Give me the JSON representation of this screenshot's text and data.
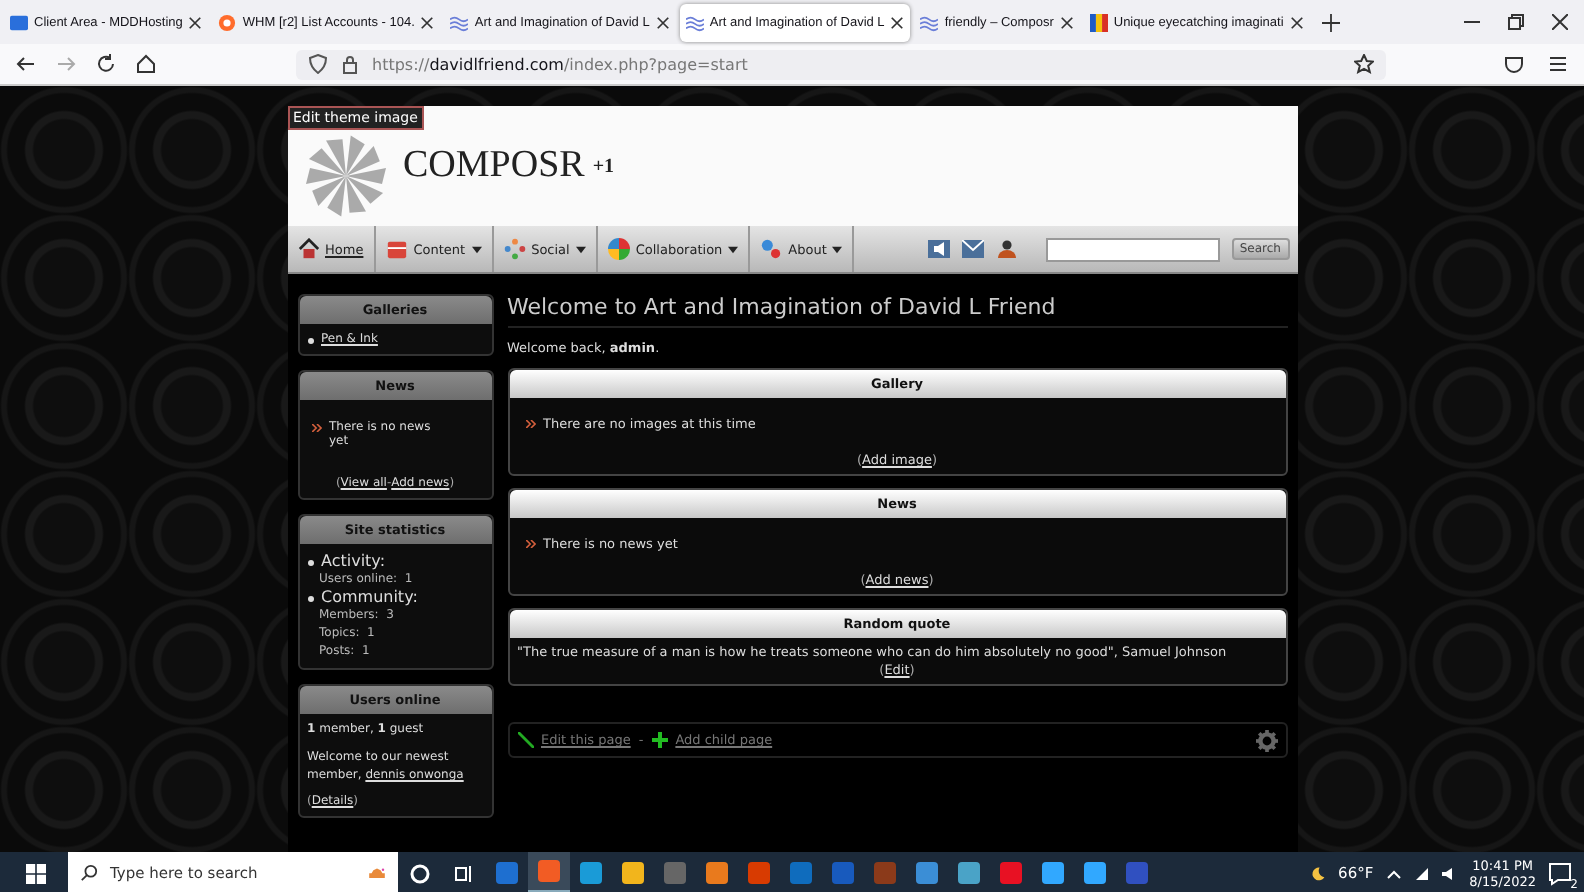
{
  "browser": {
    "tabs": [
      {
        "title": "Client Area - MDDHosting",
        "selected": false
      },
      {
        "title": "WHM [r2] List Accounts - 104.",
        "selected": false
      },
      {
        "title": "Art and Imagination of David L",
        "selected": false
      },
      {
        "title": "Art and Imagination of David L",
        "selected": true
      },
      {
        "title": "friendly – Composr",
        "selected": false
      },
      {
        "title": "Unique eyecatching imaginati",
        "selected": false
      }
    ],
    "url": "https://**davidlfriend.com**/index.php?page=start"
  },
  "site": {
    "edit_theme_label": "Edit theme image",
    "logo_text": "COMPOSR",
    "logo_suffix": "+1",
    "nav": [
      {
        "label": "Home",
        "dropdown": false,
        "selected": true
      },
      {
        "label": "Content",
        "dropdown": true,
        "selected": false
      },
      {
        "label": "Social",
        "dropdown": true,
        "selected": false
      },
      {
        "label": "Collaboration",
        "dropdown": true,
        "selected": false
      },
      {
        "label": "About",
        "dropdown": true,
        "selected": false
      }
    ],
    "search_button": "Search"
  },
  "sidebar": [
    {
      "title": "Galleries",
      "kind": "links",
      "items": [
        "Pen & Ink"
      ]
    },
    {
      "title": "News",
      "kind": "news",
      "message": "There is no news yet",
      "link_row": {
        "open": "(",
        "links": [
          "View all",
          "Add news"
        ],
        "separator": "-",
        "close": ")"
      }
    },
    {
      "title": "Site statistics",
      "kind": "stats",
      "groups": [
        {
          "heading": "Activity:",
          "lines": [
            "Users online:  1"
          ]
        },
        {
          "heading": "Community:",
          "lines": [
            "Members:  3",
            "Topics:  1",
            "Posts:  1"
          ]
        }
      ]
    },
    {
      "title": "Users online",
      "kind": "online",
      "summary": "**1** member, **1** guest",
      "newest_label": "Welcome to our newest member,",
      "newest_member": "dennis onwonga",
      "link_row": {
        "open": "(",
        "links": [
          "Details"
        ],
        "close": ")"
      }
    }
  ],
  "main": {
    "title": "Welcome to Art and Imagination of David L Friend",
    "welcome": "Welcome back, **admin**.",
    "panels": [
      {
        "title": "Gallery",
        "kind": "message",
        "message": "There are no images at this time",
        "link_row": {
          "open": "(",
          "links": [
            "Add image"
          ],
          "close": ")"
        }
      },
      {
        "title": "News",
        "kind": "message",
        "message": "There is no news yet",
        "link_row": {
          "open": "(",
          "links": [
            "Add news"
          ],
          "close": ")"
        }
      },
      {
        "title": "Random quote",
        "kind": "quote",
        "message": "\"The true measure of a man is how he treats someone who can do him absolutely no good\", Samuel Johnson",
        "link_row": {
          "open": "(",
          "links": [
            "Edit"
          ],
          "close": ")"
        }
      }
    ],
    "footer_links": [
      "Edit this page",
      "Add child page"
    ],
    "footer_separator": "-"
  },
  "taskbar": {
    "search_placeholder": "Type here to search",
    "weather": "66°F",
    "time": "10:41 PM",
    "date": "8/15/2022",
    "notifications": "2",
    "apps": [
      {
        "color": "#1e6fd0",
        "selected": false
      },
      {
        "color": "#f25c24",
        "selected": true
      },
      {
        "color": "#1a9bd7",
        "selected": false
      },
      {
        "color": "#f2b51c",
        "selected": false
      },
      {
        "color": "#666666",
        "selected": false
      },
      {
        "color": "#e97a1d",
        "selected": false
      },
      {
        "color": "#d83b01",
        "selected": false
      },
      {
        "color": "#0f6cbd",
        "selected": false
      },
      {
        "color": "#185abd",
        "selected": false
      },
      {
        "color": "#8b3a1a",
        "selected": false
      },
      {
        "color": "#3b8ed6",
        "selected": false
      },
      {
        "color": "#4aa3c7",
        "selected": false
      },
      {
        "color": "#e81123",
        "selected": false
      },
      {
        "color": "#31a8ff",
        "selected": false
      },
      {
        "color": "#31a8ff",
        "selected": false
      },
      {
        "color": "#3050c0",
        "selected": false
      }
    ]
  }
}
